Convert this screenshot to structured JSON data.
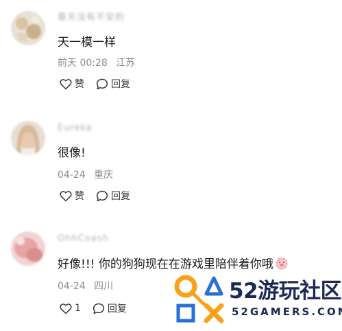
{
  "comments": [
    {
      "username": "春天没有不安的",
      "text": "天一模一样",
      "time": "前天 00:28",
      "location": "江苏",
      "like_label": "赞",
      "reply_label": "回复"
    },
    {
      "username": "Eureka",
      "text": "很像!",
      "time": "04-24",
      "location": "重庆",
      "like_label": "赞",
      "reply_label": "回复"
    },
    {
      "username": "OhhCoash",
      "text": "好像!!! 你的狗狗现在在游戏里陪伴着你哦",
      "time": "04-24",
      "location": "四川",
      "like_label": "1",
      "reply_label": "回复"
    }
  ],
  "watermark": {
    "brand": "52游玩社区",
    "domain": "52GAMERS.COM"
  },
  "colors": {
    "logo_orange": "#f7a21b",
    "logo_blue": "#2a6fd6",
    "logo_dark": "#1b2a55"
  }
}
